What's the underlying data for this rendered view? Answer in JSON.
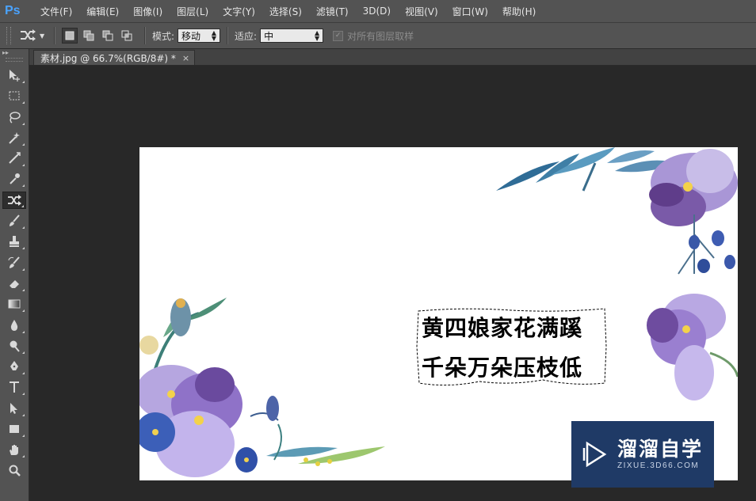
{
  "app": {
    "logo": "Ps"
  },
  "menu": [
    "文件(F)",
    "编辑(E)",
    "图像(I)",
    "图层(L)",
    "文字(Y)",
    "选择(S)",
    "滤镜(T)",
    "3D(D)",
    "视图(V)",
    "窗口(W)",
    "帮助(H)"
  ],
  "options": {
    "tool_icon": "content-aware-move-icon",
    "mode_label": "模式:",
    "mode_value": "移动",
    "adapt_label": "适应:",
    "adapt_value": "中",
    "sample_all_label": "对所有图层取样",
    "sample_all_checked": true
  },
  "document": {
    "tab_title": "素材.jpg @ 66.7%(RGB/8#) *",
    "tab_close": "×"
  },
  "tools": [
    "move-icon",
    "rect-marquee-icon",
    "lasso-icon",
    "magic-wand-icon",
    "crop-icon",
    "eyedropper-icon",
    "content-aware-move-icon",
    "brush-icon",
    "stamp-icon",
    "history-brush-icon",
    "eraser-icon",
    "gradient-icon",
    "blur-icon",
    "dodge-icon",
    "pen-icon",
    "type-icon",
    "path-select-icon",
    "rectangle-icon",
    "hand-icon",
    "zoom-icon"
  ],
  "canvas": {
    "poem_line1": "黄四娘家花满蹊",
    "poem_line2": "千朵万朵压枝低"
  },
  "watermark": {
    "title": "溜溜自学",
    "url": "ZIXUE.3D66.COM"
  },
  "colors": {
    "accent": "#4aa3ff",
    "watermark_bg": "#1f3a66"
  }
}
